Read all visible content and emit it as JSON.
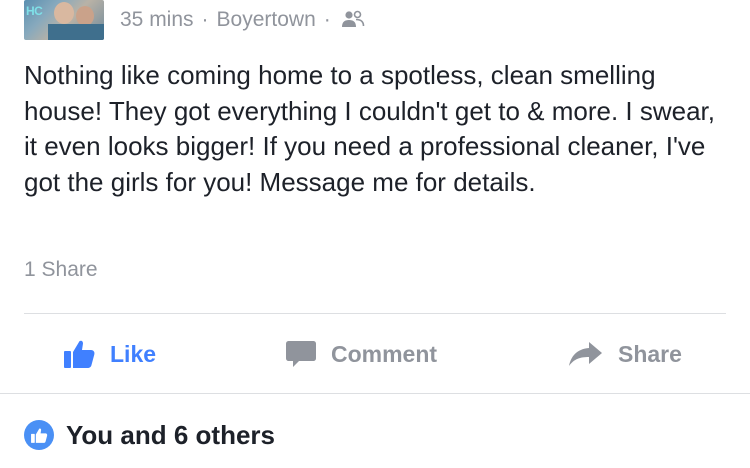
{
  "post": {
    "avatar_text": "HC",
    "time": "35 mins",
    "separator": "·",
    "location": "Boyertown",
    "separator2": "·",
    "privacy_icon": "friends-icon",
    "text": "Nothing like coming home to a spotless, clean smelling house! They got everything I couldn't get to & more. I swear, it even looks bigger! If you need a professional cleaner, I've got the girls for you! Message me for details.",
    "share_count": "1 Share"
  },
  "actions": {
    "like_label": "Like",
    "comment_label": "Comment",
    "share_label": "Share"
  },
  "reactions": {
    "icon": "like-badge-icon",
    "text": "You and 6 others"
  },
  "colors": {
    "accent": "#4080ff",
    "meta_gray": "#90949c",
    "text": "#1d2129",
    "divider": "#dddfe2"
  }
}
